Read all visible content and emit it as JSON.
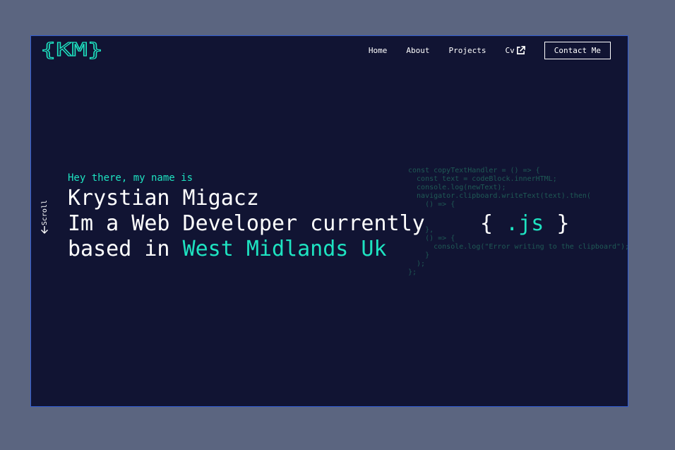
{
  "logo": {
    "text": "{KM}"
  },
  "nav": {
    "items": [
      {
        "label": "Home"
      },
      {
        "label": "About"
      },
      {
        "label": "Projects"
      },
      {
        "label": "Cv",
        "icon": "external-link-icon"
      }
    ],
    "contact_label": "Contact Me"
  },
  "scroll": {
    "label": "Scroll",
    "icon": "arrow-down-icon"
  },
  "hero": {
    "greeting": "Hey there, my name is",
    "name": "Krystian Migacz",
    "line2": "Im a Web Developer currently",
    "line3_prefix": "based in ",
    "location": "West Midlands Uk"
  },
  "code_snippet": "const copyTextHandler = () => {\n  const text = codeBlock.innerHTML;\n  console.log(newText);\n  navigator.clipboard.writeText(text).then(\n    () => {\n\n\n    },\n    () => {\n      console.log(\"Error writing to the clipboard\");\n    }\n  );\n};",
  "js_badge": {
    "open": "{",
    "text": ".js",
    "close": "}"
  },
  "colors": {
    "background": "#111433",
    "accent": "#1ee3c1",
    "outer": "#5b6580",
    "frame_border": "#2f5bd0",
    "code_dim": "#1f5a55"
  }
}
